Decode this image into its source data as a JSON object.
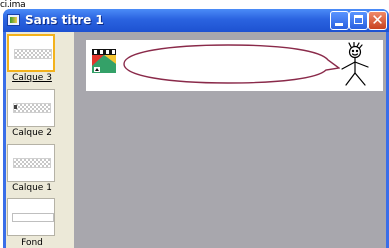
{
  "stray_text": "ci.ima",
  "window": {
    "title": "Sans titre 1",
    "buttons": [
      "minimize",
      "maximize",
      "close"
    ],
    "close_glyph": "✕",
    "accent": "#2a63e0",
    "workspace_color": "#a8a7ad"
  },
  "layers": [
    {
      "label": "Calque 3",
      "selected": true,
      "thumb": "transparent-checker"
    },
    {
      "label": "Calque 2",
      "selected": false,
      "thumb": "transparent-checker-marked"
    },
    {
      "label": "Calque 1",
      "selected": false,
      "thumb": "transparent-checker"
    },
    {
      "label": "Fond",
      "selected": false,
      "thumb": "white"
    }
  ],
  "canvas": {
    "elements": [
      "clapperboard-icon",
      "speech-bubble",
      "stick-figure"
    ],
    "bubble_color": "#8a2a4a"
  }
}
